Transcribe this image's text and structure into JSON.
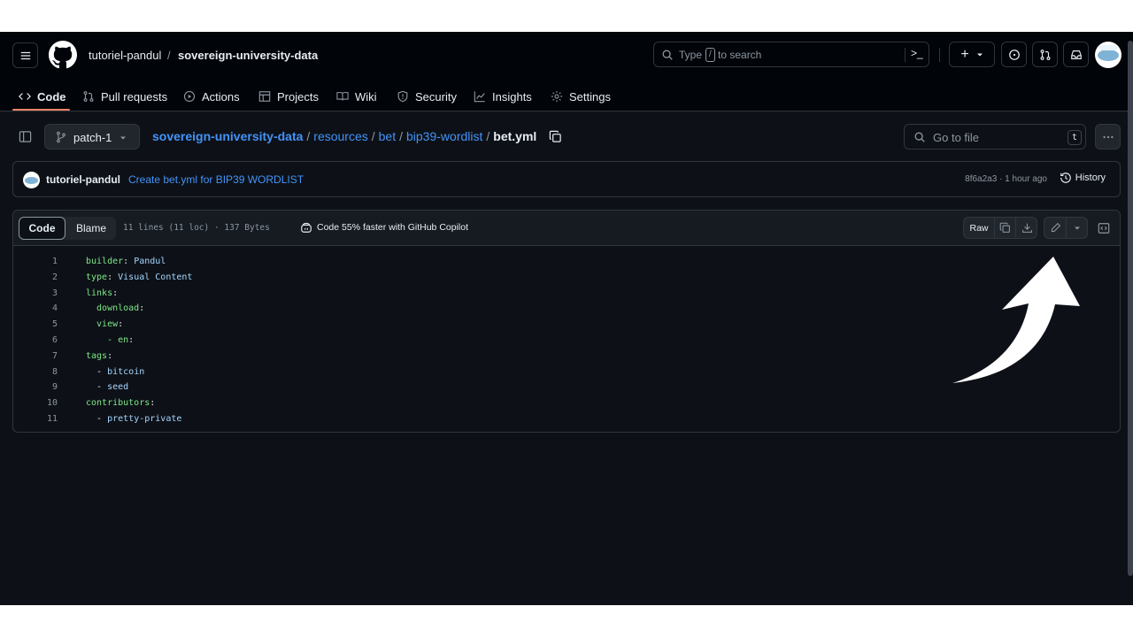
{
  "header": {
    "owner": "tutoriel-pandul",
    "separator": "/",
    "repo": "sovereign-university-data",
    "search_prefix": "Type",
    "search_key": "/",
    "search_suffix": "to search",
    "plus_label": "+"
  },
  "nav": {
    "tabs": [
      {
        "label": "Code"
      },
      {
        "label": "Pull requests"
      },
      {
        "label": "Actions"
      },
      {
        "label": "Projects"
      },
      {
        "label": "Wiki"
      },
      {
        "label": "Security"
      },
      {
        "label": "Insights"
      },
      {
        "label": "Settings"
      }
    ]
  },
  "file_header": {
    "branch": "patch-1",
    "breadcrumb": [
      "sovereign-university-data",
      "resources",
      "bet",
      "bip39-wordlist"
    ],
    "file_name": "bet.yml",
    "sep": "/",
    "go_to_file": "Go to file",
    "shortcut": "t"
  },
  "commit": {
    "author": "tutoriel-pandul",
    "message": "Create bet.yml for BIP39 WORDLIST",
    "meta": "8f6a2a3 · 1 hour ago",
    "history_label": "History"
  },
  "toolbar": {
    "code_tab": "Code",
    "blame_tab": "Blame",
    "file_info": "11 lines (11 loc) · 137 Bytes",
    "copilot": "Code 55% faster with GitHub Copilot",
    "raw": "Raw"
  },
  "code": {
    "lines": [
      {
        "n": "1",
        "key": "builder",
        "punct": ": ",
        "val": "Pandul"
      },
      {
        "n": "2",
        "key": "type",
        "punct": ": ",
        "val": "Visual Content"
      },
      {
        "n": "3",
        "key": "links",
        "punct": ":",
        "val": ""
      },
      {
        "n": "4",
        "key": "  download",
        "punct": ":",
        "val": ""
      },
      {
        "n": "5",
        "key": "  view",
        "punct": ":",
        "val": ""
      },
      {
        "n": "6",
        "key": "    - en",
        "punct": ":",
        "val": ""
      },
      {
        "n": "7",
        "key": "tags",
        "punct": ":",
        "val": ""
      },
      {
        "n": "8",
        "key": "  - ",
        "punct": "",
        "val": "bitcoin"
      },
      {
        "n": "9",
        "key": "  - ",
        "punct": "",
        "val": "seed"
      },
      {
        "n": "10",
        "key": "contributors",
        "punct": ":",
        "val": ""
      },
      {
        "n": "11",
        "key": "  - ",
        "punct": "",
        "val": "pretty-private"
      }
    ]
  },
  "colors": {
    "background": "#0d1117",
    "header_bg": "#010409",
    "accent_link": "#4493f8",
    "yaml_key": "#7ee787",
    "yaml_value": "#a5d6ff",
    "tab_underline": "#f78166"
  }
}
